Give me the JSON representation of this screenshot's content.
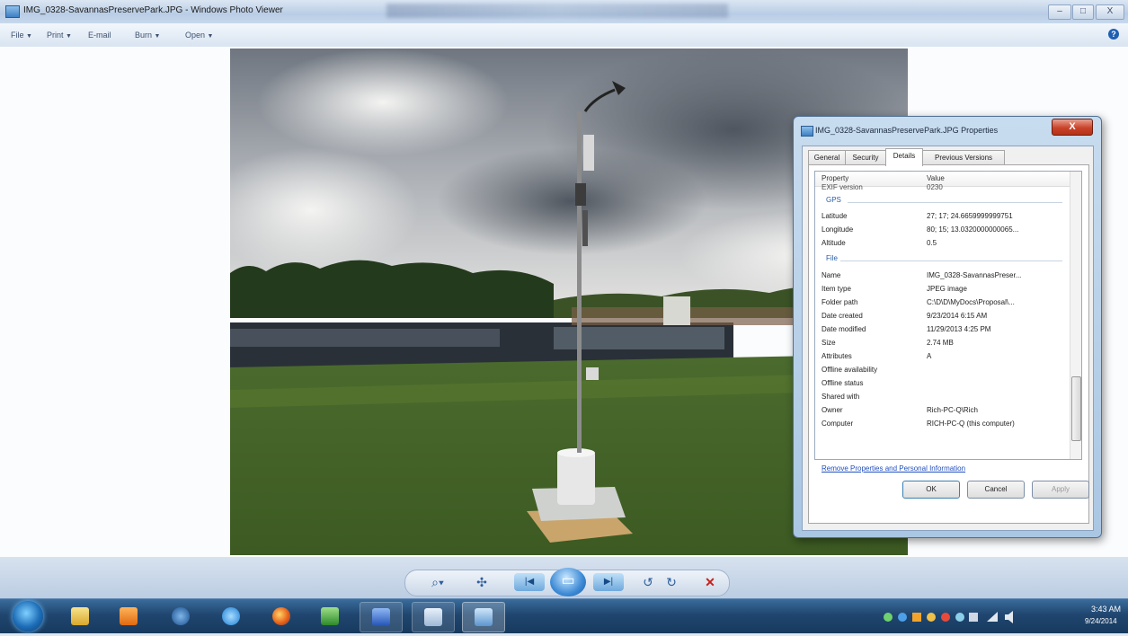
{
  "window": {
    "title": "IMG_0328-SavannasPreservePark.JPG - Windows Photo Viewer",
    "minimize_label": "–",
    "maximize_label": "□",
    "close_label": "X"
  },
  "menu": {
    "items": [
      {
        "label": "File",
        "arrow": "▼"
      },
      {
        "label": "Print",
        "arrow": "▼"
      },
      {
        "label": "E-mail",
        "arrow": ""
      },
      {
        "label": "Burn",
        "arrow": "▼"
      },
      {
        "label": "Open",
        "arrow": "▼"
      }
    ],
    "help_label": "?"
  },
  "photo": {
    "subject": "weather station mast on grassy field by a pond under cloudy sky"
  },
  "controls": {
    "zoom_label": "⌕▾",
    "actual_size_label": "✣",
    "previous_label": "|◀",
    "slideshow_label": "▭",
    "next_label": "▶|",
    "rotate_ccw_label": "↺",
    "rotate_cw_label": "↻",
    "delete_label": "✕"
  },
  "dialog": {
    "title": "IMG_0328-SavannasPreservePark.JPG Properties",
    "close_label": "X",
    "tabs": [
      "General",
      "Security",
      "Details",
      "Previous Versions"
    ],
    "active_tab": "Details",
    "columns": {
      "property": "Property",
      "value": "Value"
    },
    "clipped_row": {
      "key": "EXIF version",
      "value": "0230"
    },
    "gps_group": "GPS",
    "gps_rows": [
      {
        "key": "Latitude",
        "value": "27; 17; 24.6659999999751"
      },
      {
        "key": "Longitude",
        "value": "80; 15; 13.0320000000065..."
      },
      {
        "key": "Altitude",
        "value": "0.5"
      }
    ],
    "file_group": "File",
    "file_rows": [
      {
        "key": "Name",
        "value": "IMG_0328-SavannasPreser..."
      },
      {
        "key": "Item type",
        "value": "JPEG image"
      },
      {
        "key": "Folder path",
        "value": "C:\\D\\D\\MyDocs\\Proposal\\..."
      },
      {
        "key": "Date created",
        "value": "9/23/2014 6:15 AM"
      },
      {
        "key": "Date modified",
        "value": "11/29/2013 4:25 PM"
      },
      {
        "key": "Size",
        "value": "2.74 MB"
      },
      {
        "key": "Attributes",
        "value": "A"
      },
      {
        "key": "Offline availability",
        "value": ""
      },
      {
        "key": "Offline status",
        "value": ""
      },
      {
        "key": "Shared with",
        "value": ""
      },
      {
        "key": "Owner",
        "value": "Rich-PC-Q\\Rich"
      },
      {
        "key": "Computer",
        "value": "RICH-PC-Q (this computer)"
      }
    ],
    "remove_link": "Remove Properties and Personal Information",
    "ok_label": "OK",
    "cancel_label": "Cancel",
    "apply_label": "Apply"
  },
  "taskbar": {
    "pinned": [
      "windows-explorer",
      "media-player",
      "hp",
      "internet-explorer",
      "firefox",
      "excel",
      "word",
      "notepad",
      "photo-viewer"
    ],
    "clock_time": "3:43 AM",
    "clock_date": "9/24/2014"
  }
}
